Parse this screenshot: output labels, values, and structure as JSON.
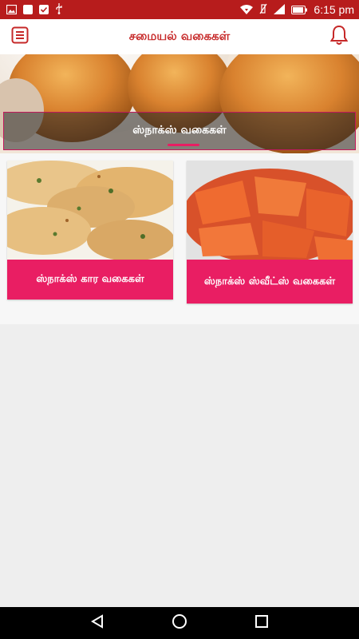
{
  "status_bar": {
    "time": "6:15 pm",
    "icons": [
      "image-icon",
      "notification-icon",
      "check-icon",
      "usb-icon",
      "wifi-icon",
      "mute-icon",
      "signal-icon",
      "battery-icon"
    ]
  },
  "app_bar": {
    "title": "சமையல் வகைகள்",
    "icons": [
      "menu-icon",
      "bell-icon"
    ],
    "accent_color": "#c62828"
  },
  "banner": {
    "label": "ஸ்நாக்ஸ் வகைகள்"
  },
  "cards": [
    {
      "label": "ஸ்நாக்ஸ் கார வகைகள்"
    },
    {
      "label": "ஸ்நாக்ஸ் ஸ்வீட்ஸ் வகைகள்"
    }
  ],
  "colors": {
    "status_bar": "#b71c1c",
    "card_label": "#e91e63"
  },
  "nav_bar": {
    "icons": [
      "back-icon",
      "home-icon",
      "recents-icon"
    ]
  }
}
